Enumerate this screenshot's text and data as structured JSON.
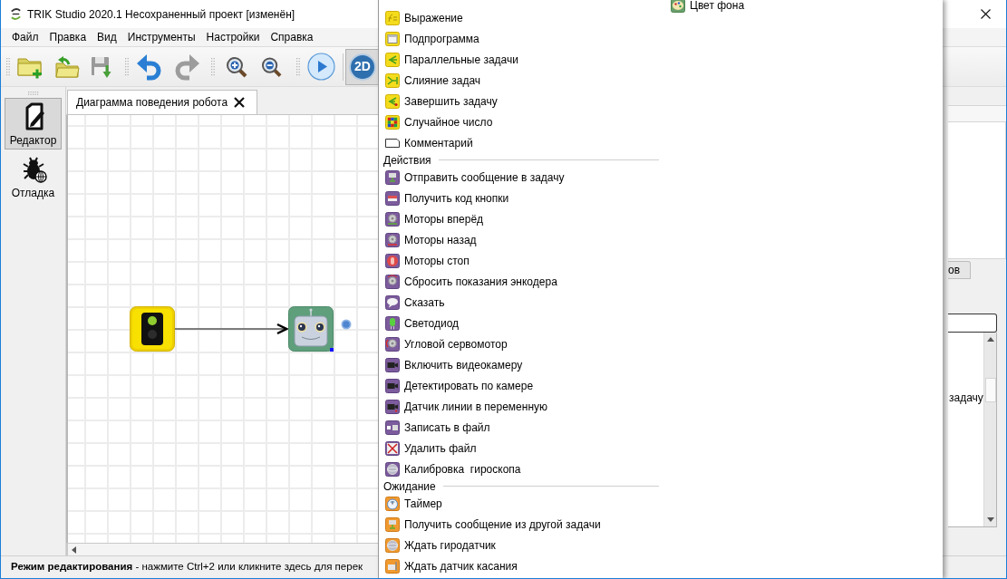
{
  "window": {
    "title": "TRIK Studio 2020.1 Несохраненный проект [изменён]"
  },
  "menu_bar": [
    "Файл",
    "Правка",
    "Вид",
    "Инструменты",
    "Настройки",
    "Справка"
  ],
  "toolbar": {
    "mode_button": {
      "label": "2D",
      "checked": true
    }
  },
  "mode_dock": [
    {
      "label": "Редактор",
      "selected": true
    },
    {
      "label": "Отладка",
      "selected": false
    }
  ],
  "tabs": [
    {
      "label": "Диаграмма поведения робота",
      "selected": true
    }
  ],
  "status_bar": {
    "text": "**Режим редактирования** - нажмите Ctrl+2 или кликните здесь для перек"
  },
  "right_panel": {
    "tab": "ов",
    "list_items": [
      "задачу"
    ]
  },
  "block_menu": {
    "groups": [
      {
        "items": [
          "Выражение",
          "Подпрограмма",
          "Параллельные задачи",
          "Слияние задач",
          "Завершить задачу",
          "Случайное число",
          "Комментарий"
        ]
      },
      {
        "title": "Действия",
        "items": [
          "Отправить сообщение в задачу",
          "Получить код кнопки",
          "Моторы вперёд",
          "Моторы назад",
          "Моторы стоп",
          "Сбросить показания энкодера",
          "Сказать",
          "Светодиод",
          "Угловой сервомотор",
          "Включить видеокамеру",
          "Детектировать по камере",
          "Датчик линии в переменную",
          "Записать в файл",
          "Удалить файл",
          "Калибровка  гироскопа"
        ]
      },
      {
        "title": "Ожидание",
        "items": [
          "Таймер",
          "Получить сообщение из другой задачи",
          "Ждать гиродатчик",
          "Ждать датчик касания"
        ]
      }
    ],
    "column_2": [
      "Цвет фона"
    ]
  }
}
